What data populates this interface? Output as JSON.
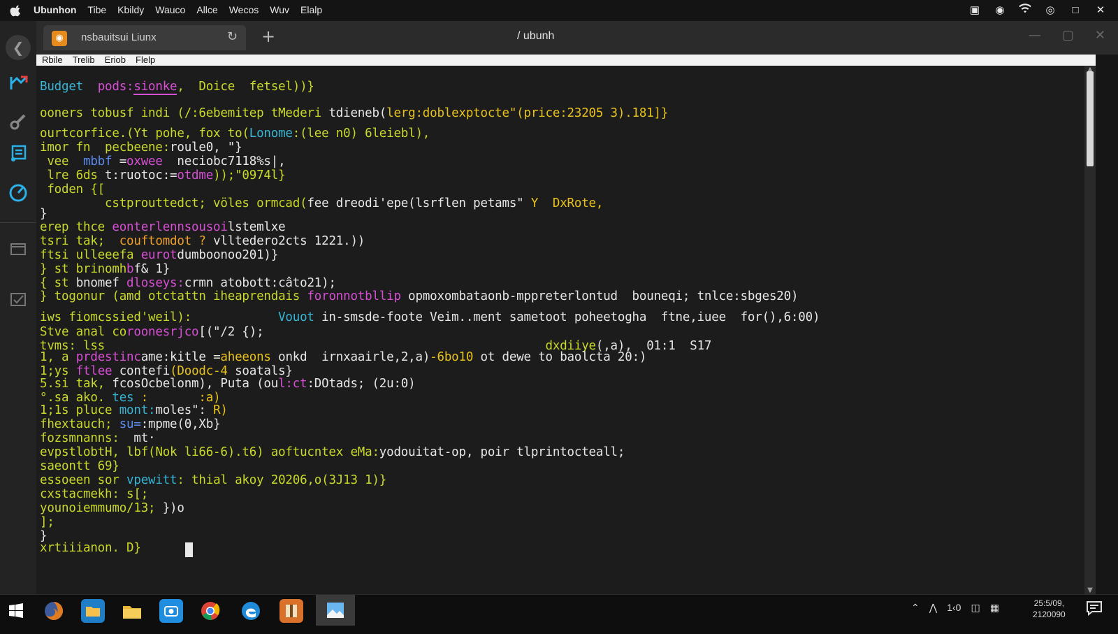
{
  "menubar": {
    "items": [
      "Ubunhon",
      "Tibe",
      "Kbildy",
      "Wauco",
      "Allce",
      "Wecos",
      "Wuv",
      "Elalp"
    ],
    "tray_icons": [
      "display-icon",
      "record-icon",
      "wifi-icon",
      "circle-icon",
      "maximize-icon",
      "close-icon"
    ]
  },
  "dock": {
    "icons": [
      "chart-icon",
      "tools-icon",
      "notes-icon",
      "compass-icon",
      "window-icon",
      "checklist-icon"
    ]
  },
  "window": {
    "tab_label": "nsbauitsui Liunx",
    "title": "/ ubunh",
    "menu": [
      "Rbile",
      "Trelib",
      "Eriob",
      "Flelp"
    ]
  },
  "terminal": {
    "lines": [
      [
        {
          "t": "Budget  ",
          "c": "c"
        },
        {
          "t": "pods:",
          "c": "m"
        },
        {
          "t": "sionke",
          "c": "m"
        },
        {
          "t": ",  Doice  fetsel))}",
          "c": "g"
        }
      ],
      [
        {
          "t": "ooners tobusf indi (/:6ebemitep tMederi ",
          "c": "g"
        },
        {
          "t": "tdieneb(",
          "c": "w"
        },
        {
          "t": "lerg:doblexptocte\"(",
          "c": "y"
        },
        {
          "t": "price:23205 3).181]}",
          "c": "y"
        }
      ],
      [
        {
          "t": "ourtcorfice.(Yt pohe, fox to(",
          "c": "g"
        },
        {
          "t": "Lonome",
          "c": "c"
        },
        {
          "t": ":(lee n0) 6leiebl),",
          "c": "g"
        }
      ],
      [
        {
          "t": "imor fn  pecbeene:",
          "c": "g"
        },
        {
          "t": "roule0",
          "c": "w"
        },
        {
          "t": ", \"}",
          "c": "w"
        }
      ],
      [
        {
          "t": " vee  ",
          "c": "g"
        },
        {
          "t": "mbbf",
          "c": "b"
        },
        {
          "t": " =",
          "c": "w"
        },
        {
          "t": "oxwee",
          "c": "m"
        },
        {
          "t": "  neciobc7118%s|,",
          "c": "w"
        }
      ],
      [
        {
          "t": " lre 6ds ",
          "c": "g"
        },
        {
          "t": "t:ruotoc:=",
          "c": "w"
        },
        {
          "t": "otdme",
          "c": "m"
        },
        {
          "t": "));\"0974l}",
          "c": "g"
        }
      ],
      [
        {
          "t": " foden {[",
          "c": "g"
        }
      ],
      [
        {
          "t": "         cstprouttedct; völes ormcad(",
          "c": "g"
        },
        {
          "t": "fee dreodi'epe(lsrflen petams\"",
          "c": "w"
        },
        {
          "t": " Y  DxRote,",
          "c": "y"
        }
      ],
      [
        {
          "t": "}",
          "c": "w"
        }
      ],
      [
        {
          "t": "erep thce ",
          "c": "g"
        },
        {
          "t": "eonterlennsousoi",
          "c": "m"
        },
        {
          "t": "lstemlxe",
          "c": "w"
        }
      ],
      [
        {
          "t": "tsri tak;  ",
          "c": "g"
        },
        {
          "t": "couftomdot ?",
          "c": "o"
        },
        {
          "t": " vlltedero2cts 1221.))",
          "c": "w"
        }
      ],
      [
        {
          "t": "ftsi ulleeefa ",
          "c": "g"
        },
        {
          "t": "eurot",
          "c": "m"
        },
        {
          "t": "dumboonoo201)}",
          "c": "w"
        }
      ],
      [
        {
          "t": "} st brinomh",
          "c": "g"
        },
        {
          "t": "b",
          "c": "m"
        },
        {
          "t": "f& 1}",
          "c": "w"
        }
      ],
      [
        {
          "t": "{ st ",
          "c": "g"
        },
        {
          "t": "bnomef",
          "c": "w"
        },
        {
          "t": " dloseys:",
          "c": "m"
        },
        {
          "t": "crmn atobott:câto21);",
          "c": "w"
        }
      ],
      [
        {
          "t": "} togonur (amd otctattn iheaprendais ",
          "c": "g"
        },
        {
          "t": "foronnotbllip",
          "c": "m"
        },
        {
          "t": " opmoxombataonb-mppreterlontud  bouneqi; tnlce:sbges20)",
          "c": "w"
        }
      ],
      [
        {
          "t": "iws fiomcssied'weil): ",
          "c": "g"
        },
        {
          "t": "           Vouot",
          "c": "c"
        },
        {
          "t": " in-smsde-foote Veim..ment sametoot poheetogha  ftne,iuee  for(),6:00)",
          "c": "w"
        }
      ],
      [
        {
          "t": "Stve anal co",
          "c": "g"
        },
        {
          "t": "roonesrjco",
          "c": "m"
        },
        {
          "t": "[(\"/2 {);",
          "c": "w"
        }
      ],
      [
        {
          "t": "tvms: lss",
          "c": "g"
        },
        {
          "t": "                                                             dxdiiye",
          "c": "g"
        },
        {
          "t": "(,a),  01:1  S17",
          "c": "w"
        }
      ],
      [
        {
          "t": "1, a ",
          "c": "g"
        },
        {
          "t": "prdestinc",
          "c": "m"
        },
        {
          "t": "ame:kitle =",
          "c": "w"
        },
        {
          "t": "aheeons",
          "c": "y"
        },
        {
          "t": " onkd  irnxaairle,2,a)",
          "c": "w"
        },
        {
          "t": "-6bo10",
          "c": "y"
        },
        {
          "t": " ot dewe to baolcta 20:)",
          "c": "w"
        }
      ],
      [
        {
          "t": "1;ys ",
          "c": "g"
        },
        {
          "t": "ftlee",
          "c": "m"
        },
        {
          "t": " contefi",
          "c": "w"
        },
        {
          "t": "(Doodc-4",
          "c": "y"
        },
        {
          "t": " soatals}",
          "c": "w"
        }
      ],
      [
        {
          "t": "5.si tak, ",
          "c": "g"
        },
        {
          "t": "fcosOcbelonm",
          "c": "w"
        },
        {
          "t": "), Puta (ou",
          "c": "w"
        },
        {
          "t": "l:ct",
          "c": "m"
        },
        {
          "t": ":DOtads; (2u:0)",
          "c": "w"
        }
      ],
      [
        {
          "t": "°.sa ako. ",
          "c": "g"
        },
        {
          "t": "tes",
          "c": "c"
        },
        {
          "t": " :       :a)",
          "c": "y"
        }
      ],
      [
        {
          "t": "1;1s pluce ",
          "c": "g"
        },
        {
          "t": "mont:",
          "c": "c"
        },
        {
          "t": "moles\": ",
          "c": "w"
        },
        {
          "t": "R)",
          "c": "y"
        }
      ],
      [
        {
          "t": "fhextauch; ",
          "c": "g"
        },
        {
          "t": "su=",
          "c": "b"
        },
        {
          "t": ":mpme(0,Xb}",
          "c": "w"
        }
      ],
      [
        {
          "t": "fozsmnanns:  ",
          "c": "g"
        },
        {
          "t": "mt·",
          "c": "w"
        }
      ],
      [
        {
          "t": "evpstlobtH, lbf(Nok li66-6).t6) aoftucntex eMa:",
          "c": "g"
        },
        {
          "t": "yodouitat-op, poir tlprintocteall;",
          "c": "w"
        }
      ],
      [
        {
          "t": "saeontt 69}",
          "c": "g"
        }
      ],
      [
        {
          "t": "essoeen sor ",
          "c": "g"
        },
        {
          "t": "vpewitt",
          "c": "c"
        },
        {
          "t": ": thial akoy 20206,o(3J13 1)}",
          "c": "g"
        }
      ],
      [
        {
          "t": "cxstacmekh: s[;",
          "c": "g"
        }
      ],
      [
        {
          "t": "younoiemmumo/13; ",
          "c": "g"
        },
        {
          "t": "})o",
          "c": "w"
        }
      ],
      [
        {
          "t": "];",
          "c": "g"
        }
      ],
      [
        {
          "t": "}",
          "c": "w"
        }
      ],
      [
        {
          "t": "",
          "c": "w"
        }
      ],
      [
        {
          "t": "xrtiiianon. D}",
          "c": "g"
        }
      ]
    ]
  },
  "taskbar": {
    "apps": [
      "windows-start-icon",
      "firefox-icon",
      "files-icon",
      "folder-icon",
      "camera-icon",
      "chrome-icon",
      "browser-icon",
      "archive-icon",
      "photos-icon"
    ],
    "tray_text": "1‹0",
    "clock_time": "25:5/09,",
    "clock_date": "2120090"
  },
  "colors": {
    "terminal_bg": "#1c1c1c",
    "accent_green": "#c9d92a",
    "accent_magenta": "#d64fd4",
    "accent_cyan": "#37b5d6",
    "accent_yellow": "#e8c21c"
  }
}
